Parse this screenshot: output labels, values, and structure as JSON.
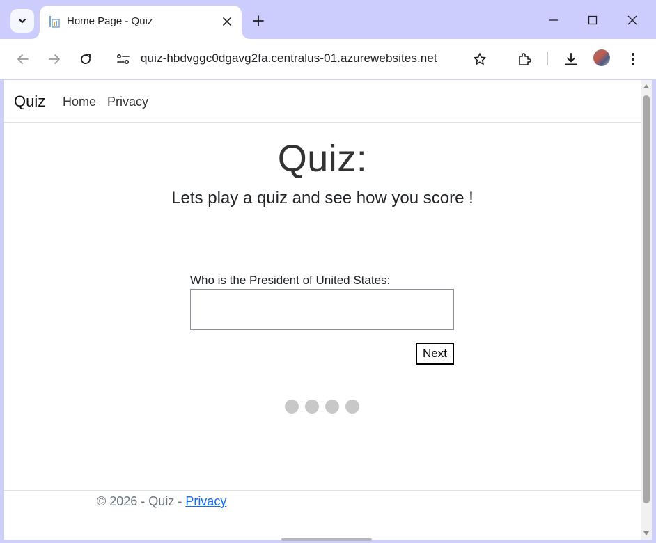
{
  "browser": {
    "tab": {
      "title": "Home Page - Quiz"
    },
    "address": {
      "url": "quiz-hbdvggc0dgavg2fa.centralus-01.azurewebsites.net"
    },
    "icons": [
      "chevron-down-icon",
      "favicon-icon",
      "close-icon",
      "plus-icon",
      "minimize-icon",
      "maximize-icon",
      "close-window-icon",
      "back-icon",
      "forward-icon",
      "reload-icon",
      "site-settings-icon",
      "star-icon",
      "extensions-icon",
      "download-icon",
      "profile-avatar",
      "more-icon"
    ],
    "colors": {
      "chrome_bg": "#cccdfc",
      "toolbar_bg": "#ffffff"
    }
  },
  "site": {
    "brand": "Quiz",
    "nav": {
      "home": "Home",
      "privacy": "Privacy"
    },
    "title": "Quiz:",
    "subtitle": "Lets play a quiz and see how you score !",
    "question": {
      "label": "Who is the President of United States:",
      "value": ""
    },
    "next_label": "Next",
    "progress": {
      "total": 4,
      "active_color": "#c8c8c8"
    },
    "footer": {
      "text": "© 2026 - Quiz - ",
      "link": "Privacy"
    }
  }
}
